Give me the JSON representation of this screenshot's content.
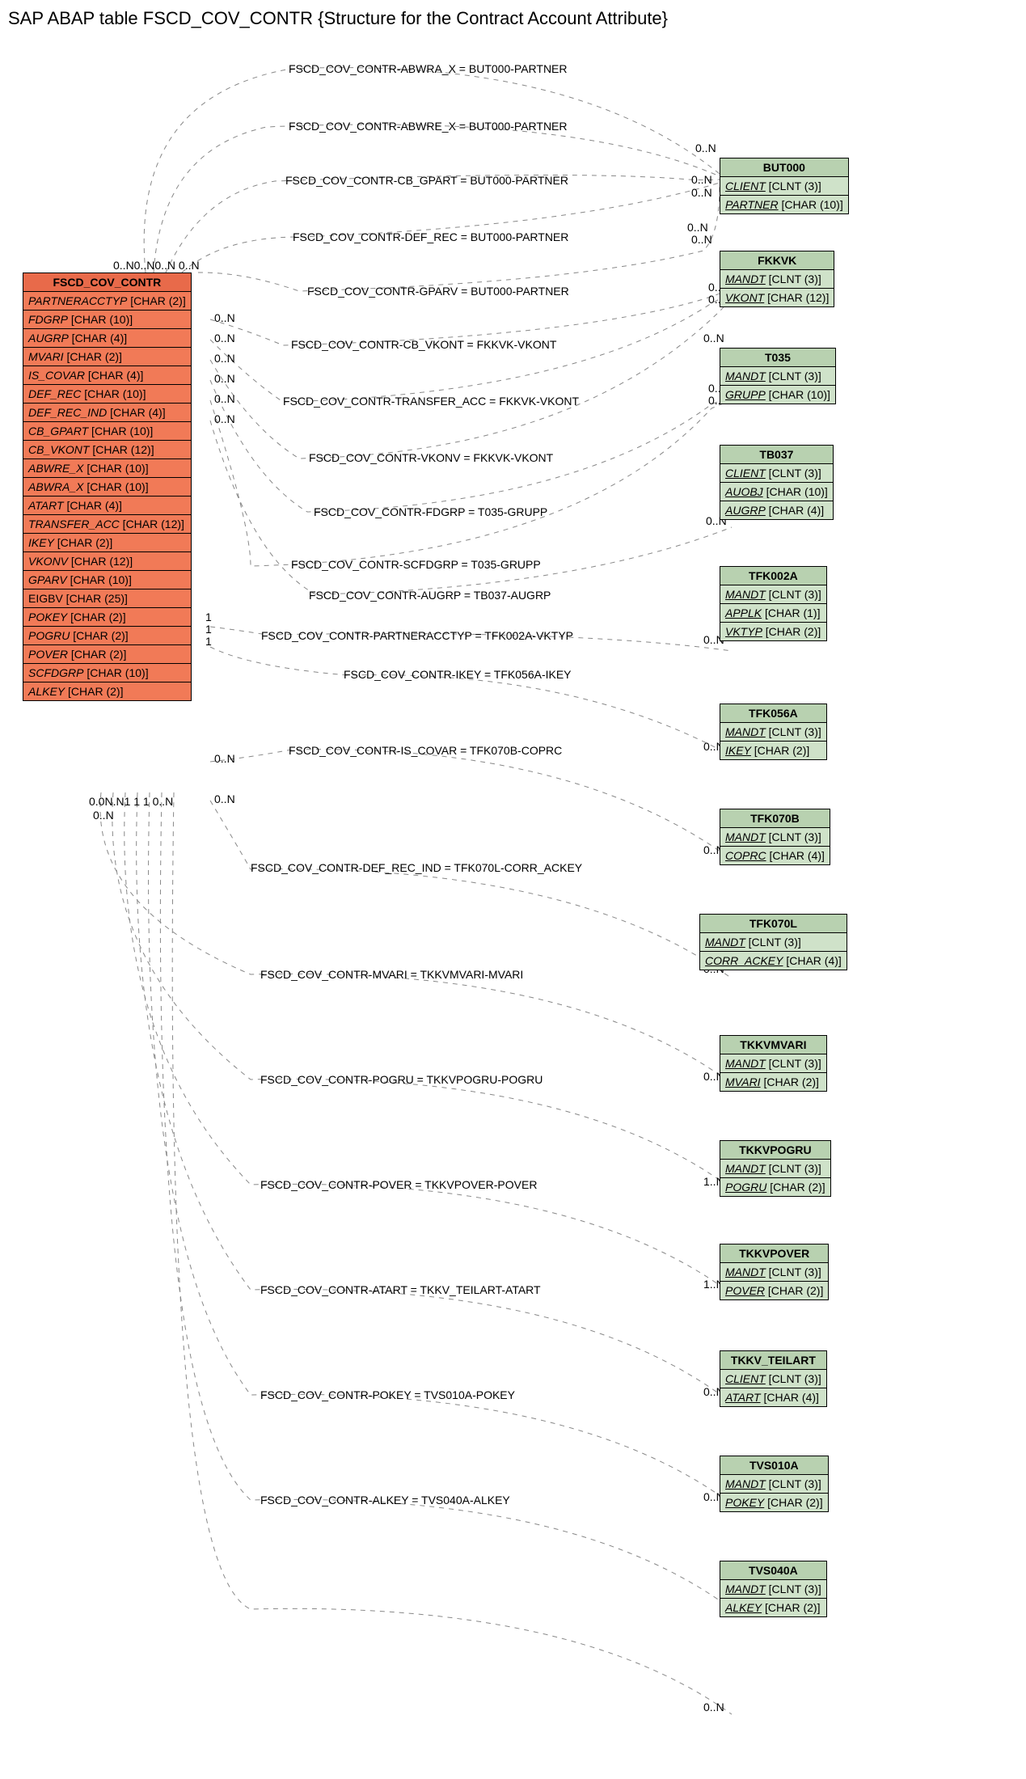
{
  "title": "SAP ABAP table FSCD_COV_CONTR {Structure for the Contract Account Attribute}",
  "main_table": {
    "name": "FSCD_COV_CONTR",
    "fields": [
      {
        "name": "PARTNERACCTYP",
        "type": "[CHAR (2)]",
        "italic": true
      },
      {
        "name": "FDGRP",
        "type": "[CHAR (10)]",
        "italic": true
      },
      {
        "name": "AUGRP",
        "type": "[CHAR (4)]",
        "italic": true
      },
      {
        "name": "MVARI",
        "type": "[CHAR (2)]",
        "italic": true
      },
      {
        "name": "IS_COVAR",
        "type": "[CHAR (4)]",
        "italic": true
      },
      {
        "name": "DEF_REC",
        "type": "[CHAR (10)]",
        "italic": true
      },
      {
        "name": "DEF_REC_IND",
        "type": "[CHAR (4)]",
        "italic": true
      },
      {
        "name": "CB_GPART",
        "type": "[CHAR (10)]",
        "italic": true
      },
      {
        "name": "CB_VKONT",
        "type": "[CHAR (12)]",
        "italic": true
      },
      {
        "name": "ABWRE_X",
        "type": "[CHAR (10)]",
        "italic": true
      },
      {
        "name": "ABWRA_X",
        "type": "[CHAR (10)]",
        "italic": true
      },
      {
        "name": "ATART",
        "type": "[CHAR (4)]",
        "italic": true
      },
      {
        "name": "TRANSFER_ACC",
        "type": "[CHAR (12)]",
        "italic": true
      },
      {
        "name": "IKEY",
        "type": "[CHAR (2)]",
        "italic": true
      },
      {
        "name": "VKONV",
        "type": "[CHAR (12)]",
        "italic": true
      },
      {
        "name": "GPARV",
        "type": "[CHAR (10)]",
        "italic": true
      },
      {
        "name": "EIGBV",
        "type": "[CHAR (25)]",
        "italic": false
      },
      {
        "name": "POKEY",
        "type": "[CHAR (2)]",
        "italic": true
      },
      {
        "name": "POGRU",
        "type": "[CHAR (2)]",
        "italic": true
      },
      {
        "name": "POVER",
        "type": "[CHAR (2)]",
        "italic": true
      },
      {
        "name": "SCFDGRP",
        "type": "[CHAR (10)]",
        "italic": true
      },
      {
        "name": "ALKEY",
        "type": "[CHAR (2)]",
        "italic": true
      }
    ]
  },
  "related_tables": [
    {
      "name": "BUT000",
      "fields": [
        [
          "CLIENT",
          "[CLNT (3)]"
        ],
        [
          "PARTNER",
          "[CHAR (10)]"
        ]
      ]
    },
    {
      "name": "FKKVK",
      "fields": [
        [
          "MANDT",
          "[CLNT (3)]"
        ],
        [
          "VKONT",
          "[CHAR (12)]"
        ]
      ]
    },
    {
      "name": "T035",
      "fields": [
        [
          "MANDT",
          "[CLNT (3)]"
        ],
        [
          "GRUPP",
          "[CHAR (10)]"
        ]
      ]
    },
    {
      "name": "TB037",
      "fields": [
        [
          "CLIENT",
          "[CLNT (3)]"
        ],
        [
          "AUOBJ",
          "[CHAR (10)]"
        ],
        [
          "AUGRP",
          "[CHAR (4)]"
        ]
      ]
    },
    {
      "name": "TFK002A",
      "fields": [
        [
          "MANDT",
          "[CLNT (3)]"
        ],
        [
          "APPLK",
          "[CHAR (1)]"
        ],
        [
          "VKTYP",
          "[CHAR (2)]"
        ]
      ]
    },
    {
      "name": "TFK056A",
      "fields": [
        [
          "MANDT",
          "[CLNT (3)]"
        ],
        [
          "IKEY",
          "[CHAR (2)]"
        ]
      ]
    },
    {
      "name": "TFK070B",
      "fields": [
        [
          "MANDT",
          "[CLNT (3)]"
        ],
        [
          "COPRC",
          "[CHAR (4)]"
        ]
      ]
    },
    {
      "name": "TFK070L",
      "fields": [
        [
          "MANDT",
          "[CLNT (3)]"
        ],
        [
          "CORR_ACKEY",
          "[CHAR (4)]"
        ]
      ]
    },
    {
      "name": "TKKVMVARI",
      "fields": [
        [
          "MANDT",
          "[CLNT (3)]"
        ],
        [
          "MVARI",
          "[CHAR (2)]"
        ]
      ]
    },
    {
      "name": "TKKVPOGRU",
      "fields": [
        [
          "MANDT",
          "[CLNT (3)]"
        ],
        [
          "POGRU",
          "[CHAR (2)]"
        ]
      ]
    },
    {
      "name": "TKKVPOVER",
      "fields": [
        [
          "MANDT",
          "[CLNT (3)]"
        ],
        [
          "POVER",
          "[CHAR (2)]"
        ]
      ]
    },
    {
      "name": "TKKV_TEILART",
      "fields": [
        [
          "CLIENT",
          "[CLNT (3)]"
        ],
        [
          "ATART",
          "[CHAR (4)]"
        ]
      ]
    },
    {
      "name": "TVS010A",
      "fields": [
        [
          "MANDT",
          "[CLNT (3)]"
        ],
        [
          "POKEY",
          "[CHAR (2)]"
        ]
      ]
    },
    {
      "name": "TVS040A",
      "fields": [
        [
          "MANDT",
          "[CLNT (3)]"
        ],
        [
          "ALKEY",
          "[CHAR (2)]"
        ]
      ]
    }
  ],
  "relations": [
    "FSCD_COV_CONTR-ABWRA_X = BUT000-PARTNER",
    "FSCD_COV_CONTR-ABWRE_X = BUT000-PARTNER",
    "FSCD_COV_CONTR-CB_GPART = BUT000-PARTNER",
    "FSCD_COV_CONTR-DEF_REC = BUT000-PARTNER",
    "FSCD_COV_CONTR-GPARV = BUT000-PARTNER",
    "FSCD_COV_CONTR-CB_VKONT = FKKVK-VKONT",
    "FSCD_COV_CONTR-TRANSFER_ACC = FKKVK-VKONT",
    "FSCD_COV_CONTR-VKONV = FKKVK-VKONT",
    "FSCD_COV_CONTR-FDGRP = T035-GRUPP",
    "FSCD_COV_CONTR-SCFDGRP = T035-GRUPP",
    "FSCD_COV_CONTR-AUGRP = TB037-AUGRP",
    "FSCD_COV_CONTR-PARTNERACCTYP = TFK002A-VKTYP",
    "FSCD_COV_CONTR-IKEY = TFK056A-IKEY",
    "FSCD_COV_CONTR-IS_COVAR = TFK070B-COPRC",
    "FSCD_COV_CONTR-DEF_REC_IND = TFK070L-CORR_ACKEY",
    "FSCD_COV_CONTR-MVARI = TKKVMVARI-MVARI",
    "FSCD_COV_CONTR-POGRU = TKKVPOGRU-POGRU",
    "FSCD_COV_CONTR-POVER = TKKVPOVER-POVER",
    "FSCD_COV_CONTR-ATART = TKKV_TEILART-ATART",
    "FSCD_COV_CONTR-POKEY = TVS010A-POKEY",
    "FSCD_COV_CONTR-ALKEY = TVS040A-ALKEY"
  ],
  "cards": {
    "zn": "0..N",
    "zn0n": "0..N0..N",
    "one": "1",
    "one_n": "1..N",
    "top_cluster": "0..N0..N0..N 0..N",
    "bot_cluster": "0.0N.N1  1  1 0..N",
    "bot_single": "0..N"
  }
}
